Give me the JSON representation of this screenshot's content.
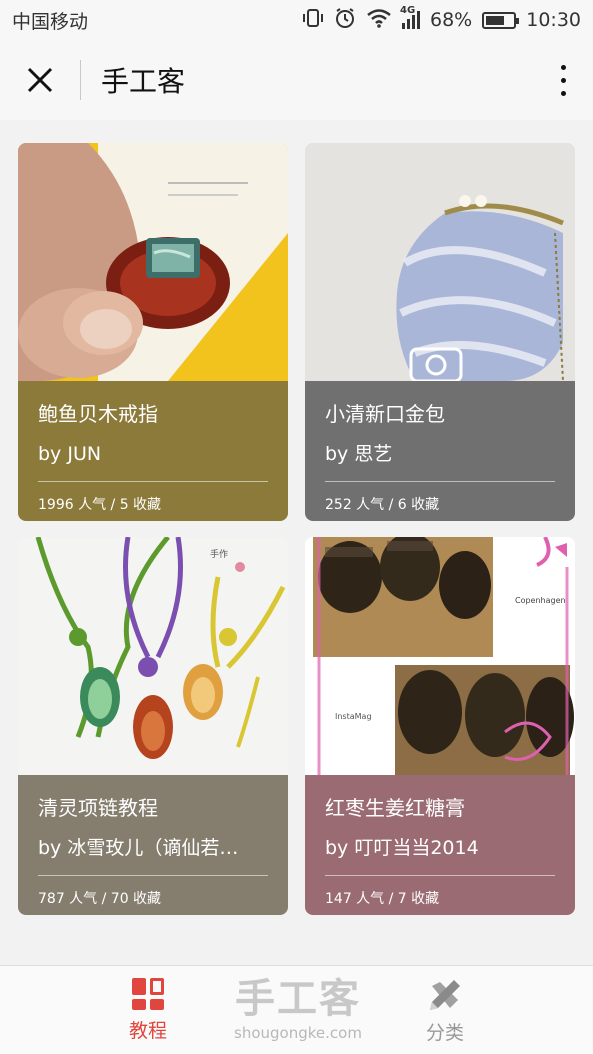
{
  "status_bar": {
    "carrier": "中国移动",
    "network": "4G",
    "battery": "68%",
    "battery_level": 0.68,
    "time": "10:30"
  },
  "header": {
    "title": "手工客",
    "close_icon": "close-icon",
    "more_icon": "more-vertical-icon"
  },
  "cards": [
    {
      "title": "鲍鱼贝木戒指",
      "author": "by JUN",
      "stats": "1996 人气 / 5 收藏",
      "color": "#8b7a3a"
    },
    {
      "title": "小清新口金包",
      "author": "by 思艺",
      "stats": "252 人气 / 6 收藏",
      "color": "#707070"
    },
    {
      "title": "清灵项链教程",
      "author": "by 冰雪玫儿（谪仙若…",
      "stats": "787 人气 / 70 收藏",
      "color": "#857d6e"
    },
    {
      "title": "红枣生姜红糖膏",
      "author": "by 叮叮当当2014",
      "stats": "147 人气 / 7 收藏",
      "color": "#9a6b72"
    }
  ],
  "bottom_bar": {
    "tab_tutorial": "教程",
    "tab_category": "分类",
    "brand_zh": "手工客",
    "brand_en": "shougongke.com",
    "active_color": "#e0463d",
    "inactive_color": "#999999"
  },
  "image_text": {
    "copenhagen": "Copenhagen",
    "instamag": "InstaMag"
  }
}
